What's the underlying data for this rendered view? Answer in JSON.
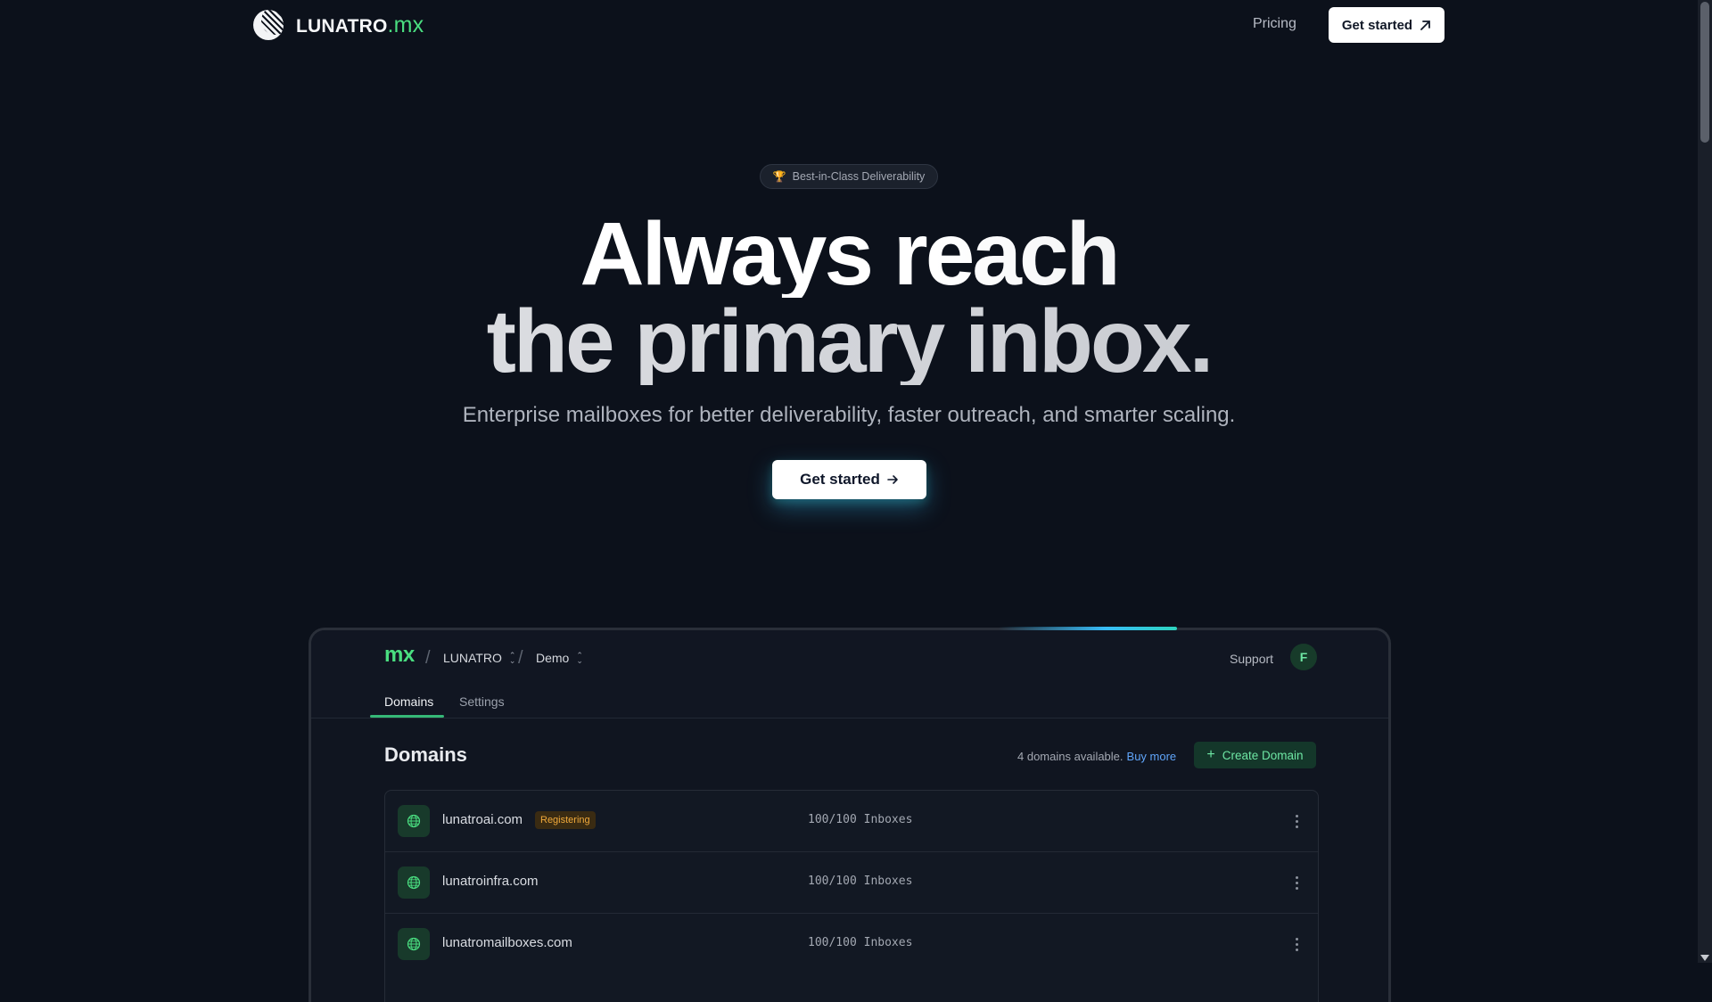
{
  "nav": {
    "brand": "LUNATRO",
    "brand_accent": ".mx",
    "pricing": "Pricing",
    "cta": "Get started"
  },
  "hero": {
    "badge": "Best-in-Class Deliverability",
    "title_line1": "Always reach",
    "title_line2": "the primary inbox.",
    "subtitle": "Enterprise mailboxes for better deliverability, faster outreach, and smarter scaling.",
    "cta": "Get started"
  },
  "app": {
    "logo": "mx",
    "org": "LUNATRO",
    "project": "Demo",
    "support": "Support",
    "avatar_initial": "F",
    "tabs": [
      {
        "label": "Domains",
        "active": true
      },
      {
        "label": "Settings",
        "active": false
      }
    ],
    "section_title": "Domains",
    "availability": "4 domains available.",
    "buy_more": "Buy more",
    "create_button": "Create Domain",
    "domains": [
      {
        "name": "lunatroai.com",
        "status": "Registering",
        "inboxes": "100/100 Inboxes"
      },
      {
        "name": "lunatroinfra.com",
        "status": "",
        "inboxes": "100/100 Inboxes"
      },
      {
        "name": "lunatromailboxes.com",
        "status": "",
        "inboxes": "100/100 Inboxes"
      }
    ]
  },
  "colors": {
    "background": "#0c111b",
    "accent_green": "#4ade80",
    "link_blue": "#60a5fa",
    "status_amber": "#f0a93b"
  },
  "icons": {
    "logo": "crescent-moon-logo-icon",
    "badge": "trophy-icon",
    "nav_cta": "arrow-up-right-icon",
    "hero_cta": "arrow-right-icon",
    "breadcrumb_switch": "chevron-up-down-icon",
    "create": "plus-icon",
    "domain": "globe-icon",
    "row_actions": "vertical-ellipsis-icon"
  }
}
